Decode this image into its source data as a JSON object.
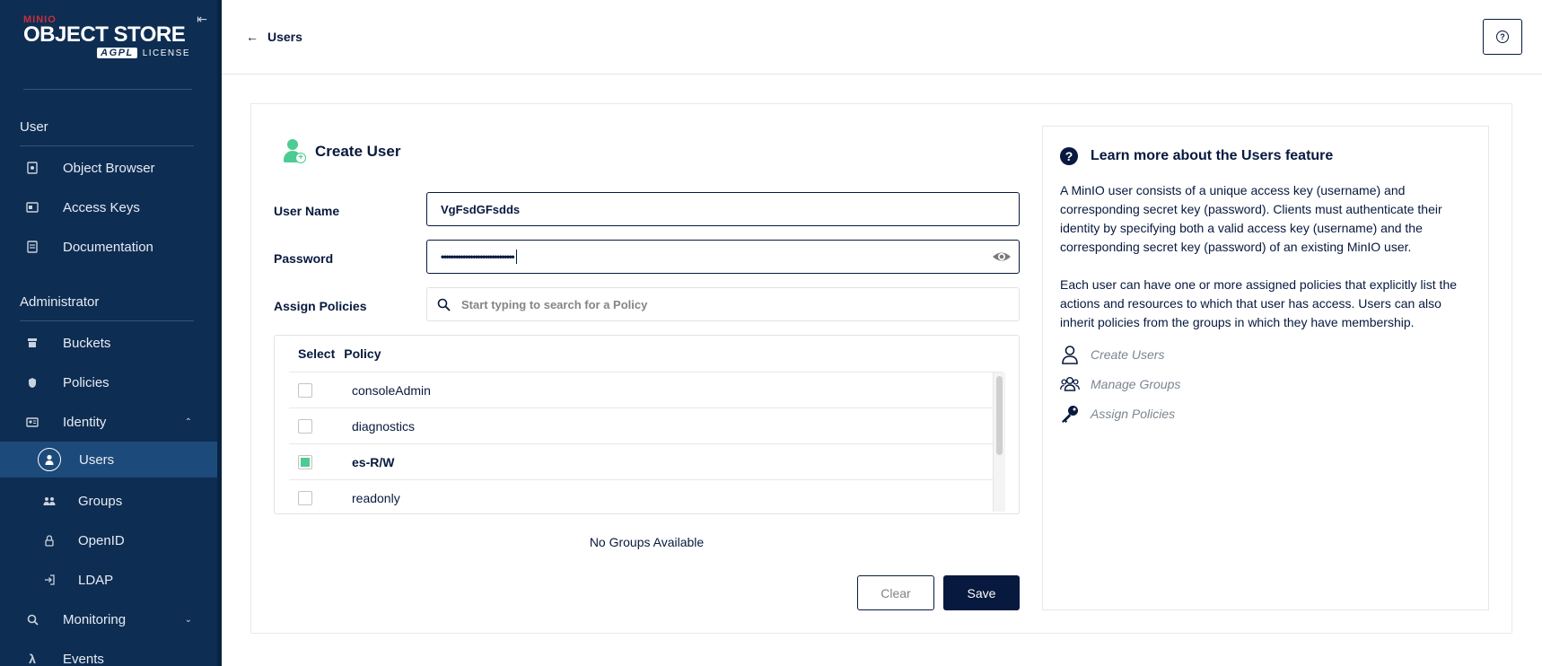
{
  "logo": {
    "brand": "MINIO",
    "title": "OBJECT STORE",
    "badge": "AGPL",
    "license": "LICENSE"
  },
  "sidebar": {
    "section_user": "User",
    "user_items": [
      {
        "label": "Object Browser",
        "icon": "object-browser-icon"
      },
      {
        "label": "Access Keys",
        "icon": "access-keys-icon"
      },
      {
        "label": "Documentation",
        "icon": "documentation-icon"
      }
    ],
    "section_admin": "Administrator",
    "admin_items": [
      {
        "label": "Buckets",
        "icon": "buckets-icon"
      },
      {
        "label": "Policies",
        "icon": "policies-icon"
      },
      {
        "label": "Identity",
        "icon": "identity-icon",
        "expanded": true
      },
      {
        "label": "Users",
        "icon": "user-icon",
        "active": true
      },
      {
        "label": "Groups",
        "icon": "groups-icon"
      },
      {
        "label": "OpenID",
        "icon": "lock-icon"
      },
      {
        "label": "LDAP",
        "icon": "login-icon"
      },
      {
        "label": "Monitoring",
        "icon": "monitoring-icon",
        "expanded": false
      },
      {
        "label": "Events",
        "icon": "lambda-icon"
      }
    ]
  },
  "header": {
    "back_label": "Users"
  },
  "form": {
    "title": "Create User",
    "username_label": "User Name",
    "username_value": "VgFsdGFsdds",
    "password_label": "Password",
    "password_value": "••••••••••••••••••••••••••••••",
    "policies_label": "Assign Policies",
    "policies_placeholder": "Start typing to search for a Policy",
    "table_headers": {
      "select": "Select",
      "policy": "Policy"
    },
    "policies": [
      {
        "name": "consoleAdmin",
        "checked": false
      },
      {
        "name": "diagnostics",
        "checked": false
      },
      {
        "name": "es-R/W",
        "checked": true
      },
      {
        "name": "readonly",
        "checked": false
      }
    ],
    "no_groups": "No Groups Available",
    "clear_label": "Clear",
    "save_label": "Save"
  },
  "help": {
    "title": "Learn more about the Users feature",
    "paragraph1": "A MinIO user consists of a unique access key (username) and corresponding secret key (password). Clients must authenticate their identity by specifying both a valid access key (username) and the corresponding secret key (password) of an existing MinIO user.",
    "paragraph2": "Each user can have one or more assigned policies that explicitly list the actions and resources to which that user has access. Users can also inherit policies from the groups in which they have membership.",
    "links": [
      {
        "label": "Create Users",
        "icon": "user-outline-icon"
      },
      {
        "label": "Manage Groups",
        "icon": "groups-outline-icon"
      },
      {
        "label": "Assign Policies",
        "icon": "key-icon"
      }
    ]
  },
  "colors": {
    "sidebar_bg": "#0e2d52",
    "active_bg": "#1c4a7a",
    "primary": "#07193e",
    "accent_green": "#4ccb92"
  }
}
